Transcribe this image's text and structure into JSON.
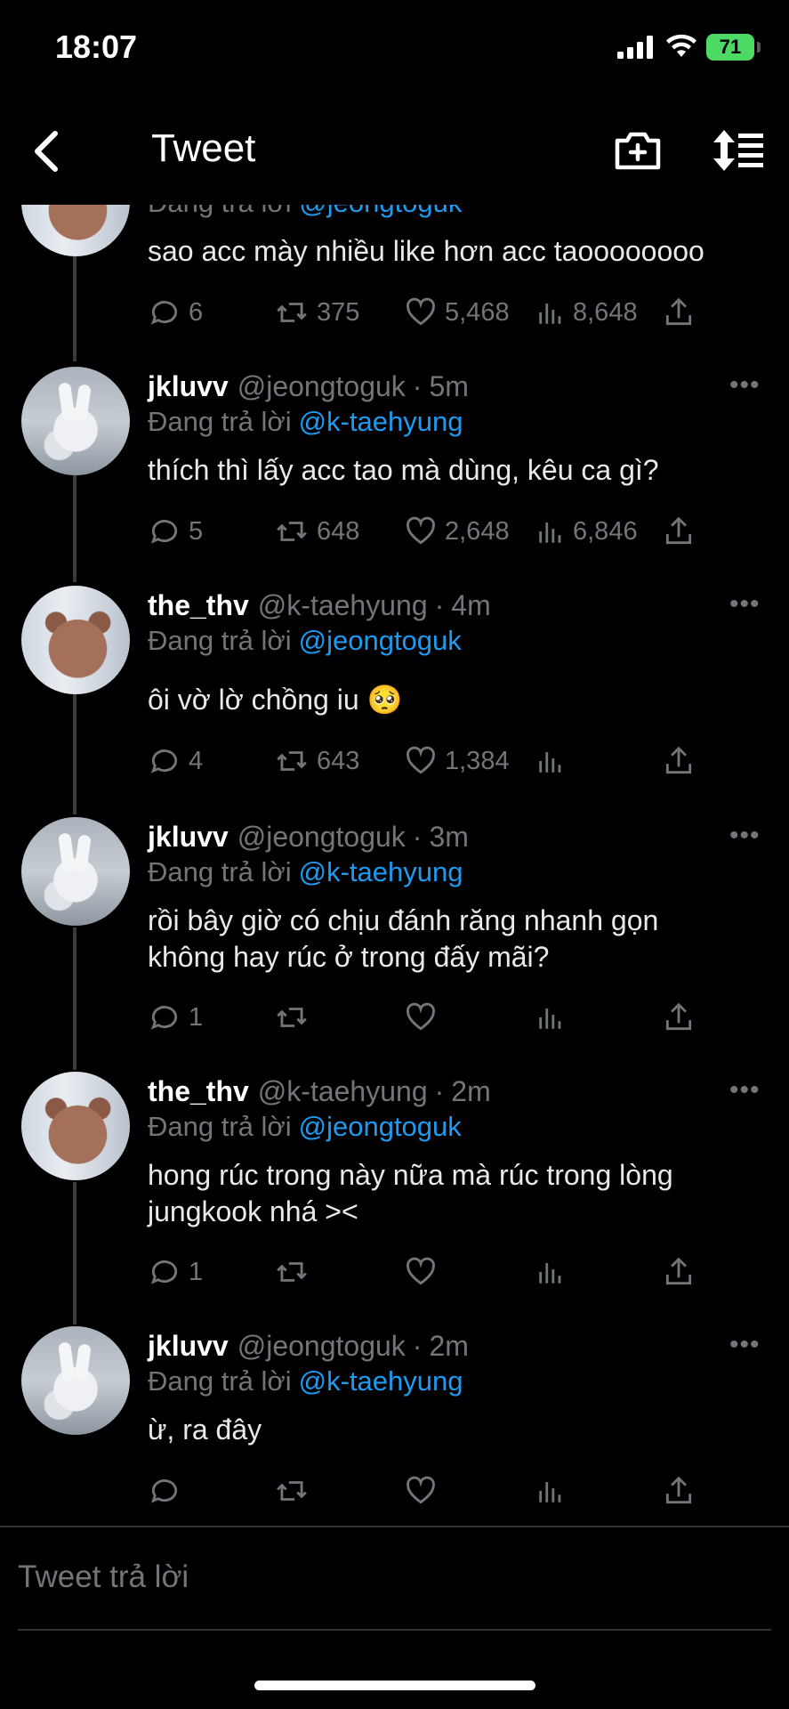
{
  "status_bar": {
    "time": "18:07",
    "battery": "71"
  },
  "header": {
    "title": "Tweet",
    "back_icon": "chevron-left-icon",
    "camera_icon": "camera-plus-icon",
    "sort_icon": "sort-icon"
  },
  "tweets": [
    {
      "partial": true,
      "replying_label": "Đang trả lời",
      "mention": "@jeongtoguk",
      "text": "sao acc mày nhiều like hơn acc taoooooooo",
      "replies": "6",
      "retweets": "375",
      "likes": "5,468",
      "views": "8,648"
    },
    {
      "name": "jkluvv",
      "handle": "@jeongtoguk",
      "time": "5m",
      "replying_label": "Đang trả lời",
      "mention": "@k-taehyung",
      "text": "thích thì lấy acc tao mà dùng, kêu ca gì?",
      "replies": "5",
      "retweets": "648",
      "likes": "2,648",
      "views": "6,846"
    },
    {
      "name": "the_thv",
      "handle": "@k-taehyung",
      "time": "4m",
      "replying_label": "Đang trả lời",
      "mention": "@jeongtoguk",
      "text": "ôi vờ lờ chồng iu 🥺",
      "replies": "4",
      "retweets": "643",
      "likes": "1,384",
      "views": ""
    },
    {
      "name": "jkluvv",
      "handle": "@jeongtoguk",
      "time": "3m",
      "replying_label": "Đang trả lời",
      "mention": "@k-taehyung",
      "text": "rồi bây giờ có chịu đánh răng nhanh gọn không hay rúc ở trong đấy mãi?",
      "replies": "1",
      "retweets": "",
      "likes": "",
      "views": ""
    },
    {
      "name": "the_thv",
      "handle": "@k-taehyung",
      "time": "2m",
      "replying_label": "Đang trả lời",
      "mention": "@jeongtoguk",
      "text": "hong rúc trong này nữa mà rúc trong lòng jungkook nhá ><",
      "replies": "1",
      "retweets": "",
      "likes": "",
      "views": ""
    },
    {
      "name": "jkluvv",
      "handle": "@jeongtoguk",
      "time": "2m",
      "replying_label": "Đang trả lời",
      "mention": "@k-taehyung",
      "text": "ừ, ra đây",
      "replies": "",
      "retweets": "",
      "likes": "",
      "views": ""
    }
  ],
  "more_label": "•••",
  "reply_box": {
    "placeholder": "Tweet trả lời"
  },
  "colors": {
    "background": "#000000",
    "accent": "#1d9bf0",
    "muted": "#71767b",
    "text": "#e7e9ea",
    "battery": "#4cd964"
  }
}
